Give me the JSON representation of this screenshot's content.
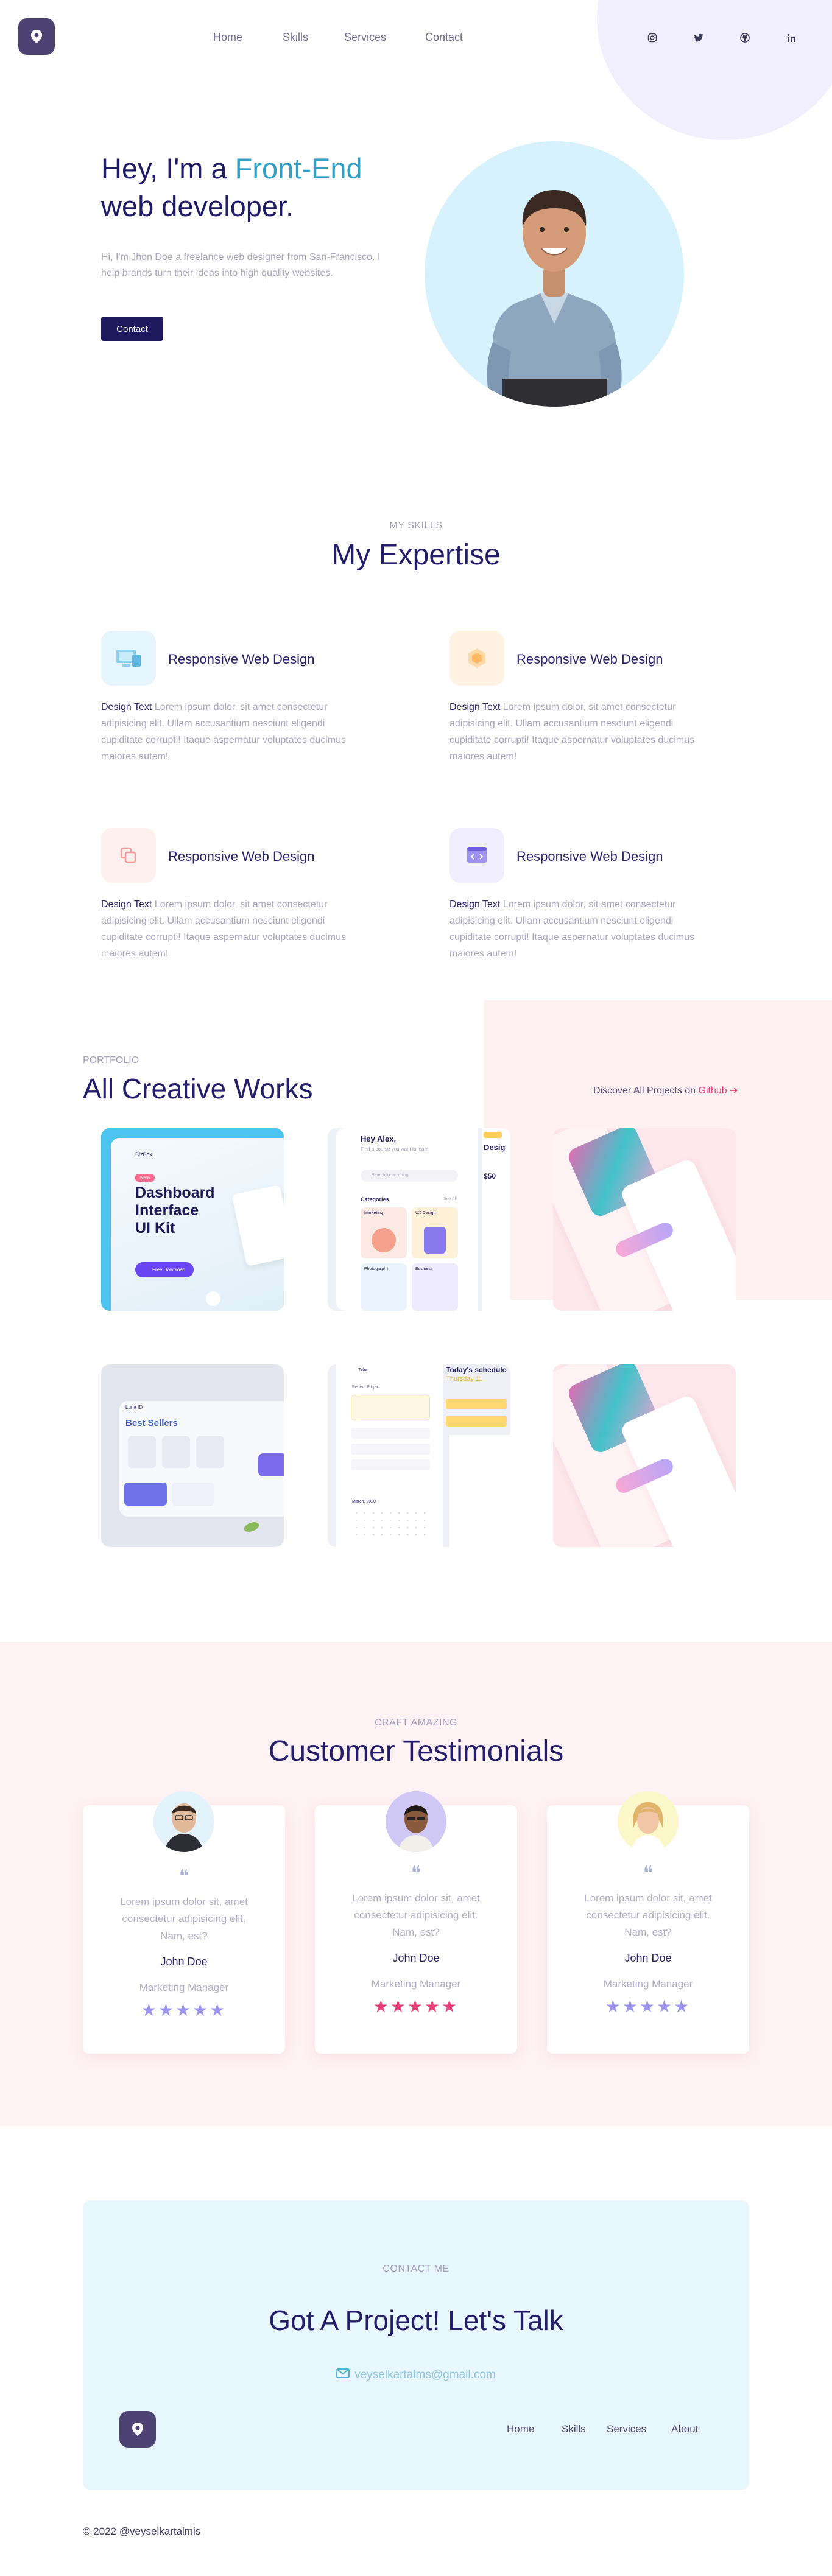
{
  "header": {
    "nav": [
      "Home",
      "Skills",
      "Services",
      "Contact"
    ],
    "social": [
      {
        "icon": "instagram-icon",
        "glyph": "◎"
      },
      {
        "icon": "twitter-icon",
        "glyph": "✦"
      },
      {
        "icon": "github-icon",
        "glyph": "◉"
      },
      {
        "icon": "linkedin-icon",
        "glyph": "in"
      }
    ]
  },
  "hero": {
    "title_prefix": "Hey, I'm a ",
    "title_accent": "Front-End",
    "title_line2": "web developer.",
    "description": "Hi, I'm Jhon Doe a freelance web designer from San-Francisco. I help brands turn their ideas into high quality websites.",
    "cta": "Contact"
  },
  "skills": {
    "eyebrow": "MY SKILLS",
    "title": "My Expertise",
    "items": [
      {
        "title": "Responsive Web Design",
        "lead": "Design Text",
        "text": " Lorem ipsum dolor, sit amet consectetur adipisicing elit. Ullam accusantium nesciunt eligendi cupiditate corrupti! Itaque aspernatur voluptates ducimus maiores autem!",
        "icon": "monitor-icon"
      },
      {
        "title": "Responsive Web Design",
        "lead": "Design Text",
        "text": " Lorem ipsum dolor, sit amet consectetur adipisicing elit. Ullam accusantium nesciunt eligendi cupiditate corrupti! Itaque aspernatur voluptates ducimus maiores autem!",
        "icon": "layers-icon"
      },
      {
        "title": "Responsive Web Design",
        "lead": "Design Text",
        "text": " Lorem ipsum dolor, sit amet consectetur adipisicing elit. Ullam accusantium nesciunt eligendi cupiditate corrupti! Itaque aspernatur voluptates ducimus maiores autem!",
        "icon": "copy-icon"
      },
      {
        "title": "Responsive Web Design",
        "lead": "Design Text",
        "text": " Lorem ipsum dolor, sit amet consectetur adipisicing elit. Ullam accusantium nesciunt eligendi cupiditate corrupti! Itaque aspernatur voluptates ducimus maiores autem!",
        "icon": "code-window-icon"
      }
    ]
  },
  "portfolio": {
    "eyebrow": "PORTFOLIO",
    "title": "All Creative Works",
    "discover_prefix": "Discover All Projects on ",
    "discover_link": "Github",
    "cards": {
      "dashboard": {
        "brand": "BizBox",
        "badge": "New",
        "heading_l1": "Dashboard",
        "heading_l2": "Interface",
        "heading_l3": "UI Kit",
        "button": "Free Download"
      },
      "course": {
        "greeting": "Hey Alex,",
        "sub": "Find a course you want to learn",
        "search": "Search for anything",
        "categories": "Categories",
        "see_all": "See All",
        "c1": "Marketing",
        "c2": "UX Design",
        "c3": "Photography",
        "c4": "Business",
        "price": "$50",
        "side": "Desig"
      },
      "shop": {
        "brand": "Luna ID",
        "title": "Best Sellers"
      },
      "schedule": {
        "brand": "Teba",
        "label": "Today's schedule",
        "day": "Thursday 11",
        "recent": "Recent Project",
        "month": "March, 2020"
      }
    }
  },
  "testimonials": {
    "eyebrow": "CRAFT AMAZING",
    "title": "Customer Testimonials",
    "items": [
      {
        "text": "Lorem ipsum dolor sit, amet consectetur adipisicing elit. Nam, est?",
        "name": "John Doe",
        "role": "Marketing Manager",
        "stars": "★★★★★",
        "star_color": "#9c94ee"
      },
      {
        "text": "Lorem ipsum dolor sit, amet consectetur adipisicing elit. Nam, est?",
        "name": "John Doe",
        "role": "Marketing Manager",
        "stars": "★★★★★",
        "star_color": "#e93e75"
      },
      {
        "text": "Lorem ipsum dolor sit, amet consectetur adipisicing elit. Nam, est?",
        "name": "John Doe",
        "role": "Marketing Manager",
        "stars": "★★★★★",
        "star_color": "#9c94ee"
      }
    ]
  },
  "contact": {
    "eyebrow": "CONTACT ME",
    "title": "Got A Project! Let's Talk",
    "email": "veyselkartalms@gmail.com"
  },
  "footer": {
    "nav": [
      "Home",
      "Skills",
      "Services",
      "About"
    ],
    "copyright": "© 2022 @veyselkartalmis"
  },
  "colors": {
    "navy": "#1f1862",
    "accent_blue": "#32a0c5",
    "pink_accent": "#e93e75",
    "hero_circle": "#d7f1fd",
    "testimonial_bg": "#fff2f4",
    "contact_bg": "#e8f6fd"
  }
}
